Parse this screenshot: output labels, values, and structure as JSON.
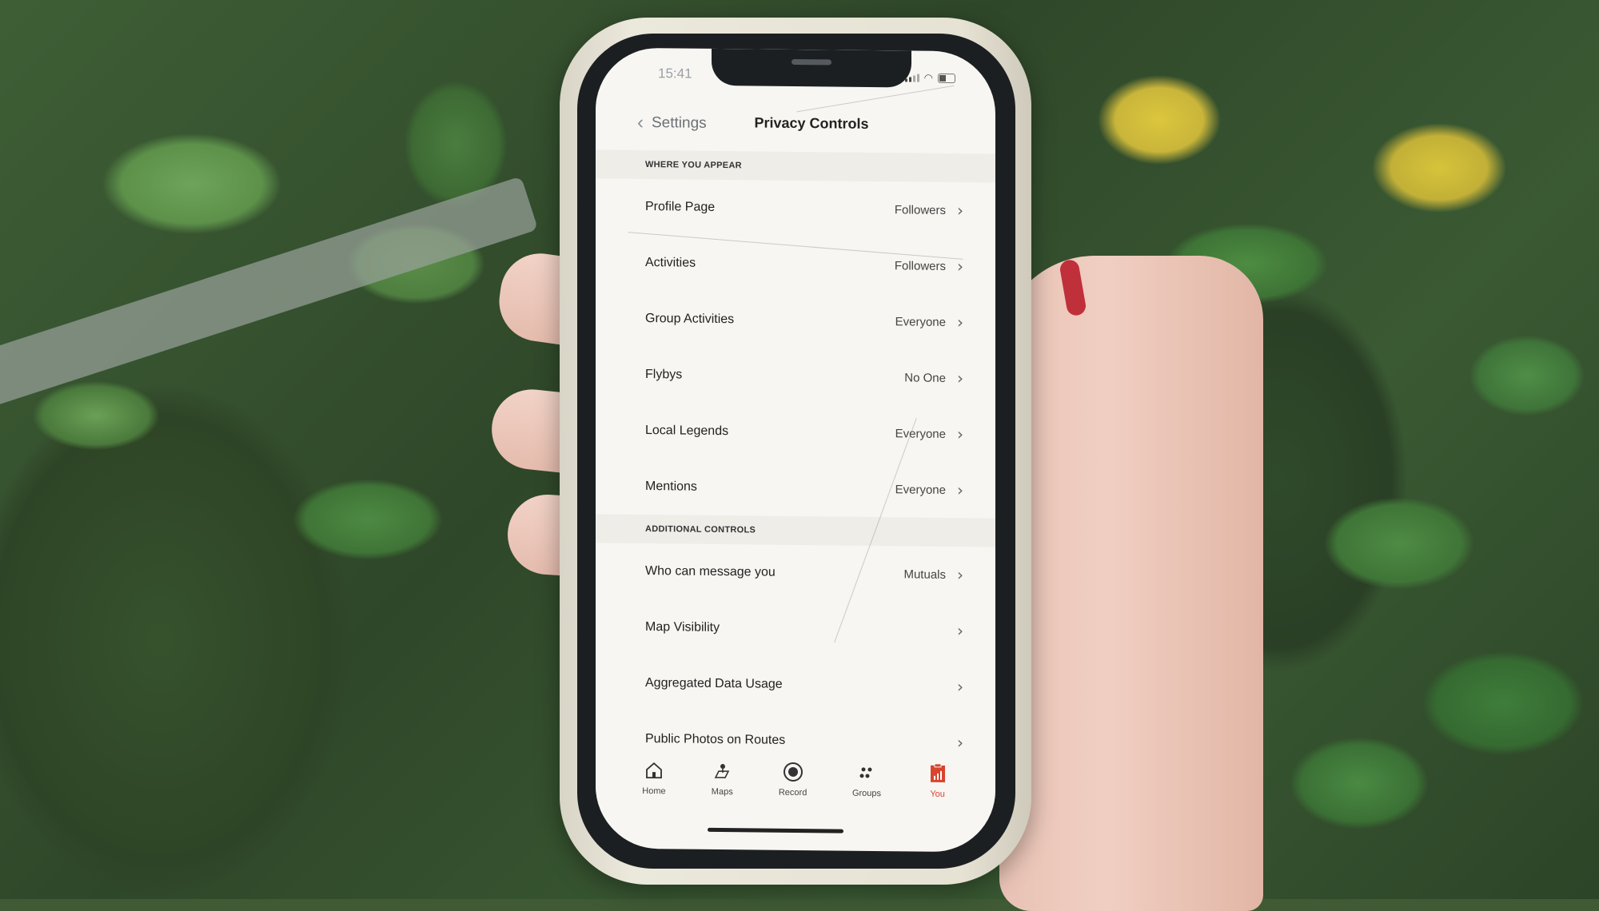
{
  "status_bar": {
    "time": "15:41"
  },
  "nav": {
    "back_label": "Settings",
    "title": "Privacy Controls"
  },
  "sections": [
    {
      "header": "WHERE YOU APPEAR",
      "rows": [
        {
          "label": "Profile Page",
          "value": "Followers"
        },
        {
          "label": "Activities",
          "value": "Followers"
        },
        {
          "label": "Group Activities",
          "value": "Everyone"
        },
        {
          "label": "Flybys",
          "value": "No One"
        },
        {
          "label": "Local Legends",
          "value": "Everyone"
        },
        {
          "label": "Mentions",
          "value": "Everyone"
        }
      ]
    },
    {
      "header": "ADDITIONAL CONTROLS",
      "rows": [
        {
          "label": "Who can message you",
          "value": "Mutuals"
        },
        {
          "label": "Map Visibility",
          "value": ""
        },
        {
          "label": "Aggregated Data Usage",
          "value": ""
        },
        {
          "label": "Public Photos on Routes",
          "value": ""
        }
      ]
    }
  ],
  "tab_bar": {
    "items": [
      {
        "label": "Home",
        "icon": "home-icon"
      },
      {
        "label": "Maps",
        "icon": "map-pin-icon"
      },
      {
        "label": "Record",
        "icon": "record-icon"
      },
      {
        "label": "Groups",
        "icon": "groups-icon"
      },
      {
        "label": "You",
        "icon": "profile-stats-icon",
        "active": true
      }
    ]
  },
  "colors": {
    "accent": "#d8442d",
    "screen_bg": "#f7f6f2",
    "section_bg": "#efede8"
  }
}
